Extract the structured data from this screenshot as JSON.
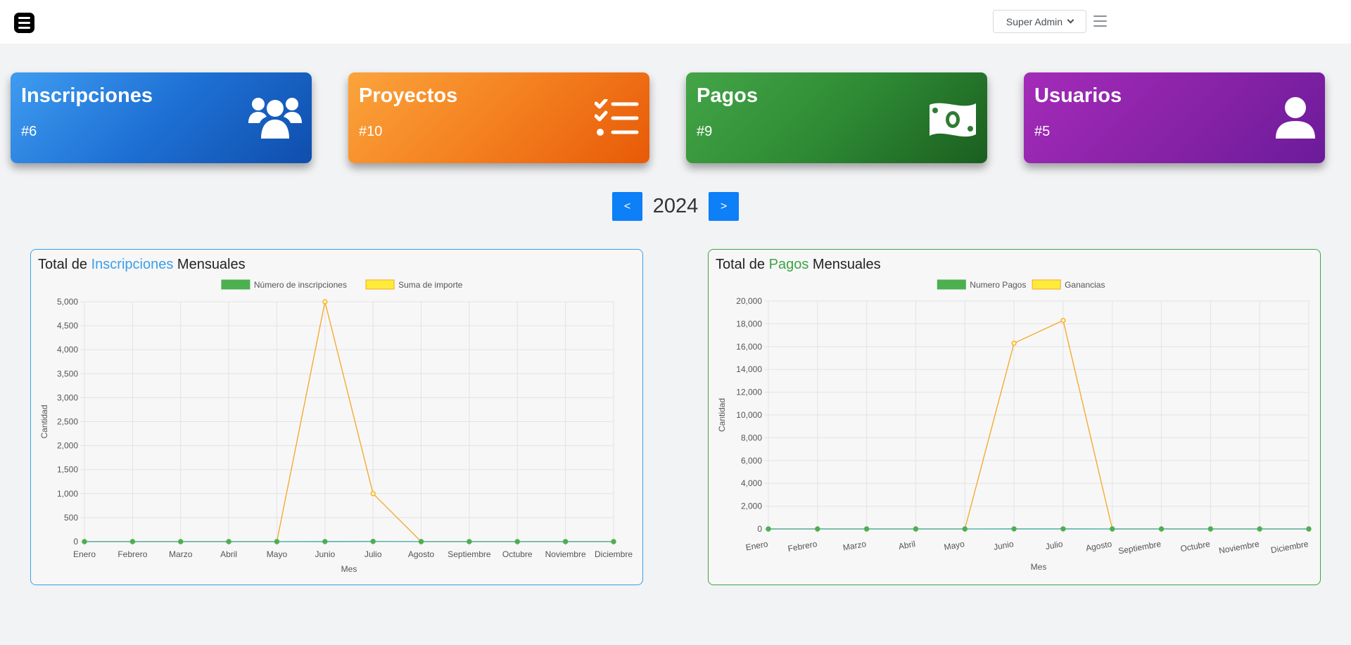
{
  "header": {
    "user_label": "Super Admin",
    "menu_icon": "bars-icon",
    "toggle_icon": "hamburger-icon"
  },
  "cards": [
    {
      "title": "Inscripciones",
      "count": "#6",
      "icon": "users-icon",
      "color": "#1e70d4"
    },
    {
      "title": "Proyectos",
      "count": "#10",
      "icon": "checklist-icon",
      "color": "#f4801f"
    },
    {
      "title": "Pagos",
      "count": "#9",
      "icon": "money-bill-icon",
      "color": "#2e8b34"
    },
    {
      "title": "Usuarios",
      "count": "#5",
      "icon": "user-icon",
      "color": "#8a23a8"
    }
  ],
  "year_nav": {
    "prev_label": "<",
    "year": "2024",
    "next_label": ">"
  },
  "panels": [
    {
      "title_prefix": "Total de",
      "title_highlight": "Inscripciones",
      "title_suffix": "Mensuales"
    },
    {
      "title_prefix": "Total de",
      "title_highlight": "Pagos",
      "title_suffix": "Mensuales"
    }
  ],
  "chart_data": [
    {
      "type": "line",
      "categories": [
        "Enero",
        "Febrero",
        "Marzo",
        "Abril",
        "Mayo",
        "Junio",
        "Julio",
        "Agosto",
        "Septiembre",
        "Octubre",
        "Noviembre",
        "Diciembre"
      ],
      "series": [
        {
          "name": "Número de inscripciones",
          "values": [
            0,
            0,
            0,
            0,
            0,
            1,
            4,
            0,
            0,
            0,
            0,
            0
          ],
          "color": "#4caf50"
        },
        {
          "name": "Suma de importe",
          "values": [
            0,
            0,
            0,
            0,
            0,
            5000,
            1000,
            0,
            0,
            0,
            0,
            0
          ],
          "color": "#f5a623"
        }
      ],
      "xlabel": "Mes",
      "ylabel": "Cantidad",
      "ylim": [
        0,
        5000
      ],
      "yticks": [
        "0",
        "500",
        "1,000",
        "1,500",
        "2,000",
        "2,500",
        "3,000",
        "3,500",
        "4,000",
        "4,500",
        "5,000"
      ],
      "x_labels_rotated": false,
      "legend": "top",
      "grid": true
    },
    {
      "type": "line",
      "categories": [
        "Enero",
        "Febrero",
        "Marzo",
        "Abril",
        "Mayo",
        "Junio",
        "Julio",
        "Agosto",
        "Septiembre",
        "Octubre",
        "Noviembre",
        "Diciembre"
      ],
      "series": [
        {
          "name": "Numero Pagos",
          "values": [
            0,
            0,
            0,
            0,
            0,
            4,
            5,
            0,
            0,
            0,
            0,
            0
          ],
          "color": "#4caf50"
        },
        {
          "name": "Ganancias",
          "values": [
            0,
            0,
            0,
            0,
            0,
            16300,
            18300,
            0,
            0,
            0,
            0,
            0
          ],
          "color": "#f5a623"
        }
      ],
      "xlabel": "Mes",
      "ylabel": "Cantidad",
      "ylim": [
        0,
        20000
      ],
      "yticks": [
        "0",
        "2,000",
        "4,000",
        "6,000",
        "8,000",
        "10,000",
        "12,000",
        "14,000",
        "16,000",
        "18,000",
        "20,000"
      ],
      "x_labels_rotated": true,
      "legend": "top",
      "grid": true
    }
  ]
}
